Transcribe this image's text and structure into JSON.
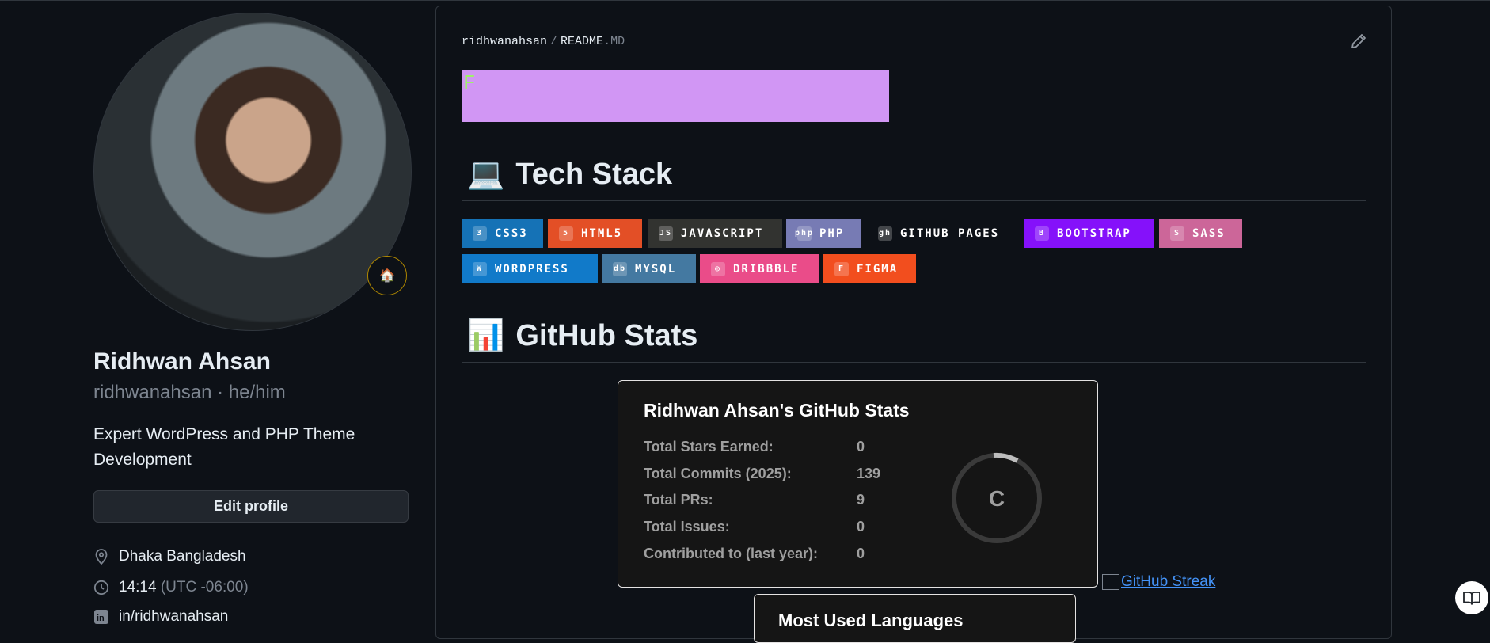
{
  "profile": {
    "name": "Ridhwan Ahsan",
    "handle_line": "ridhwanahsan · he/him",
    "bio": "Expert WordPress and PHP Theme Development",
    "edit_label": "Edit profile",
    "location": "Dhaka Bangladesh",
    "time": "14:14",
    "timezone": "(UTC -06:00)",
    "linkedin": "in/ridhwanahsan",
    "badge_emoji": "🏠"
  },
  "readme": {
    "owner": "ridhwanahsan",
    "file": "README",
    "file_ext": ".MD",
    "banner_text": "F",
    "banner_color": "#d196f4",
    "tech_heading_emoji": "💻",
    "tech_heading": "Tech Stack",
    "stats_heading_emoji": "📊",
    "stats_heading": "GitHub Stats"
  },
  "badges": [
    {
      "label": "CSS3",
      "color": "#1572b6",
      "icon": "3"
    },
    {
      "label": "HTML5",
      "color": "#e34f26",
      "icon": "5"
    },
    {
      "label": "JAVASCRIPT",
      "color": "#323330",
      "icon": "JS"
    },
    {
      "label": "PHP",
      "color": "#777bb4",
      "icon": "php"
    },
    {
      "label": "GITHUB PAGES",
      "color": "#0d1117",
      "icon": "gh"
    },
    {
      "label": "BOOTSTRAP",
      "color": "#8511fa",
      "icon": "B"
    },
    {
      "label": "SASS",
      "color": "#cc6699",
      "icon": "S"
    },
    {
      "label": "WORDPRESS",
      "color": "#117ac9",
      "icon": "W"
    },
    {
      "label": "MYSQL",
      "color": "#4479a1",
      "icon": "db"
    },
    {
      "label": "DRIBBBLE",
      "color": "#ea4c89",
      "icon": "◎"
    },
    {
      "label": "FIGMA",
      "color": "#f24e1e",
      "icon": "F"
    }
  ],
  "stats": {
    "title": "Ridhwan Ahsan's GitHub Stats",
    "rows": [
      {
        "label": "Total Stars Earned:",
        "value": "0"
      },
      {
        "label": "Total Commits (2025):",
        "value": "139"
      },
      {
        "label": "Total PRs:",
        "value": "9"
      },
      {
        "label": "Total Issues:",
        "value": "0"
      },
      {
        "label": "Contributed to (last year):",
        "value": "0"
      }
    ],
    "rank": "C",
    "streak_alt": "GitHub Streak",
    "next_card_title": "Most Used Languages"
  }
}
